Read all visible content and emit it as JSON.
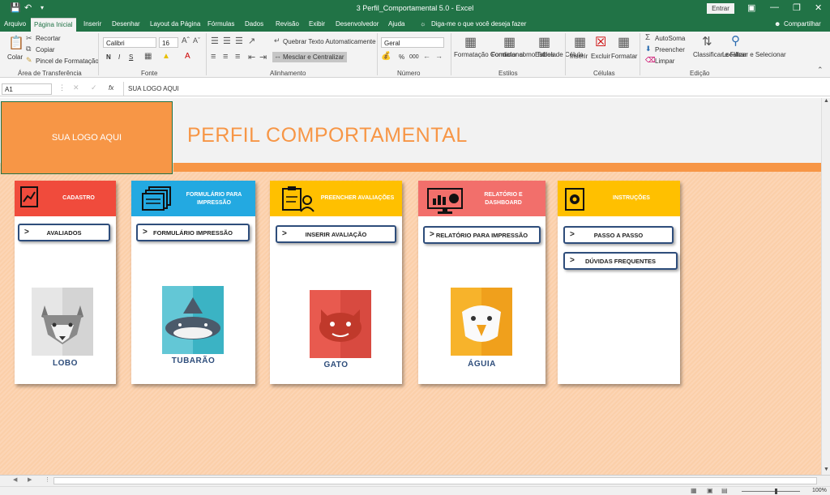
{
  "window": {
    "title": "3 Perfil_Comportamental 5.0  -  Excel",
    "sign_in": "Entrar"
  },
  "tabs": [
    "Arquivo",
    "Página Inicial",
    "Inserir",
    "Desenhar",
    "Layout da Página",
    "Fórmulas",
    "Dados",
    "Revisão",
    "Exibir",
    "Desenvolvedor",
    "Ajuda"
  ],
  "tell_me": "Diga-me o que você deseja fazer",
  "share": "Compartilhar",
  "ribbon": {
    "clipboard": {
      "paste": "Colar",
      "cut": "Recortar",
      "copy": "Copiar",
      "format_painter": "Pincel de Formatação",
      "group": "Área de Transferência"
    },
    "font": {
      "name": "Calibri",
      "size": "16",
      "bold": "N",
      "italic": "I",
      "underline": "S",
      "group": "Fonte"
    },
    "alignment": {
      "wrap": "Quebrar Texto Automaticamente",
      "merge": "Mesclar e Centralizar",
      "group": "Alinhamento"
    },
    "number": {
      "format": "Geral",
      "percent": "%",
      "thousands": "000",
      "group": "Número"
    },
    "styles": {
      "conditional": "Formatação Condicional",
      "table": "Formatar como Tabela",
      "cell": "Estilos de Célula",
      "group": "Estilos"
    },
    "cells": {
      "insert": "Inserir",
      "delete": "Excluir",
      "format": "Formatar",
      "group": "Células"
    },
    "editing": {
      "autosum": "AutoSoma",
      "fill": "Preencher",
      "clear": "Limpar",
      "sort": "Classificar e Filtrar",
      "find": "Localizar e Selecionar",
      "group": "Edição"
    }
  },
  "formula_bar": {
    "name_box": "A1",
    "fx": "fx",
    "value": "SUA LOGO AQUI"
  },
  "sheet": {
    "logo_text": "SUA LOGO AQUI",
    "title": "PERFIL COMPORTAMENTAL",
    "accent_color": "#f79646",
    "cards": [
      {
        "header": "CADASTRO",
        "color": "#f04b3c",
        "buttons": [
          "AVALIADOS"
        ],
        "animal": "LOBO"
      },
      {
        "header": "FORMULÁRIO PARA IMPRESSÃO",
        "color": "#23a9e1",
        "buttons": [
          "FORMULÁRIO IMPRESSÃO"
        ],
        "animal": "TUBARÃO"
      },
      {
        "header": "PREENCHER AVALIAÇÕES",
        "color": "#ffc000",
        "buttons": [
          "INSERIR AVALIAÇÃO"
        ],
        "animal": "GATO"
      },
      {
        "header": "RELATÓRIO E DASHBOARD",
        "color": "#f26f6b",
        "buttons": [
          "RELATÓRIO PARA IMPRESSÃO"
        ],
        "animal": "ÁGUIA"
      },
      {
        "header": "INSTRUÇÕES",
        "color": "#ffc000",
        "buttons": [
          "PASSO A PASSO",
          "DÚVIDAS FREQUENTES"
        ],
        "animal": ""
      }
    ]
  },
  "status": {
    "zoom": "100%"
  }
}
